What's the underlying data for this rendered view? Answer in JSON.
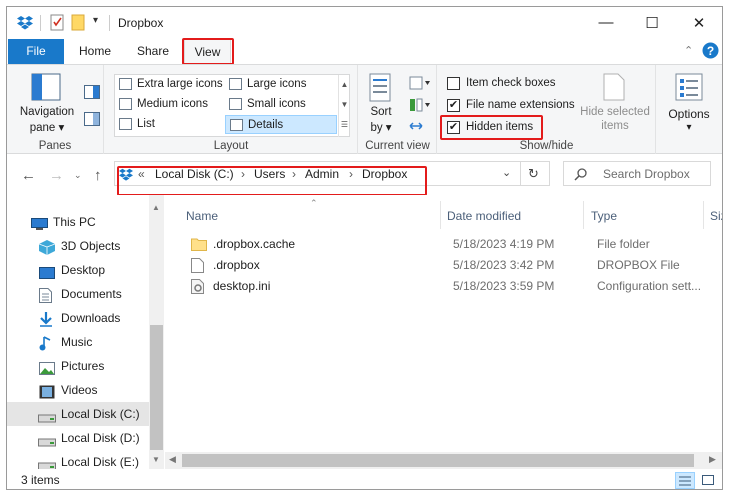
{
  "window": {
    "title": "Dropbox",
    "minimize_glyph": "—",
    "maximize_glyph": "☐",
    "close_glyph": "✕"
  },
  "tabs": [
    {
      "label": "File"
    },
    {
      "label": "Home"
    },
    {
      "label": "Share"
    },
    {
      "label": "View"
    }
  ],
  "ribbon": {
    "panes": {
      "name": "Panes",
      "nav_pane_line1": "Navigation",
      "nav_pane_line2": "pane ▾"
    },
    "layout": {
      "name": "Layout",
      "items": [
        "Extra large icons",
        "Large icons",
        "Medium icons",
        "Small icons",
        "List",
        "Details"
      ],
      "selected": "Details"
    },
    "current_view": {
      "name": "Current view",
      "sort_line1": "Sort",
      "sort_line2": "by ▾"
    },
    "show_hide": {
      "name": "Show/hide",
      "item_check_boxes": {
        "label": "Item check boxes",
        "checked": false
      },
      "file_name_extensions": {
        "label": "File name extensions",
        "checked": true
      },
      "hidden_items": {
        "label": "Hidden items",
        "checked": true
      },
      "hide_selected_line1": "Hide selected",
      "hide_selected_line2": "items",
      "check_mark": "✔"
    },
    "options": {
      "label": "Options",
      "arrow": "▾"
    }
  },
  "address": {
    "prefix": "«",
    "crumbs": [
      "Local Disk (C:)",
      "Users",
      "Admin",
      "Dropbox"
    ],
    "separator": "›",
    "search_placeholder": "Search Dropbox"
  },
  "nav": [
    {
      "label": "This PC",
      "icon": "pc-icon"
    },
    {
      "label": "3D Objects",
      "icon": "cube-icon"
    },
    {
      "label": "Desktop",
      "icon": "desktop-icon"
    },
    {
      "label": "Documents",
      "icon": "documents-icon"
    },
    {
      "label": "Downloads",
      "icon": "download-icon"
    },
    {
      "label": "Music",
      "icon": "music-icon"
    },
    {
      "label": "Pictures",
      "icon": "pictures-icon"
    },
    {
      "label": "Videos",
      "icon": "videos-icon"
    },
    {
      "label": "Local Disk (C:)",
      "icon": "drive-icon",
      "selected": true
    },
    {
      "label": "Local Disk (D:)",
      "icon": "drive-icon"
    },
    {
      "label": "Local Disk (E:)",
      "icon": "drive-icon"
    }
  ],
  "columns": [
    "Name",
    "Date modified",
    "Type",
    "Siz"
  ],
  "files": [
    {
      "name": ".dropbox.cache",
      "date": "5/18/2023 4:19 PM",
      "type": "File folder",
      "icon": "folder-icon"
    },
    {
      "name": ".dropbox",
      "date": "5/18/2023 3:42 PM",
      "type": "DROPBOX File",
      "icon": "file-icon"
    },
    {
      "name": "desktop.ini",
      "date": "5/18/2023 3:59 PM",
      "type": "Configuration sett...",
      "icon": "settings-file-icon"
    }
  ],
  "status": {
    "count": "3 items"
  },
  "colors": {
    "accent": "#1979ca",
    "highlight": "#e31b1b",
    "selected_layout": "#cce8ff"
  }
}
